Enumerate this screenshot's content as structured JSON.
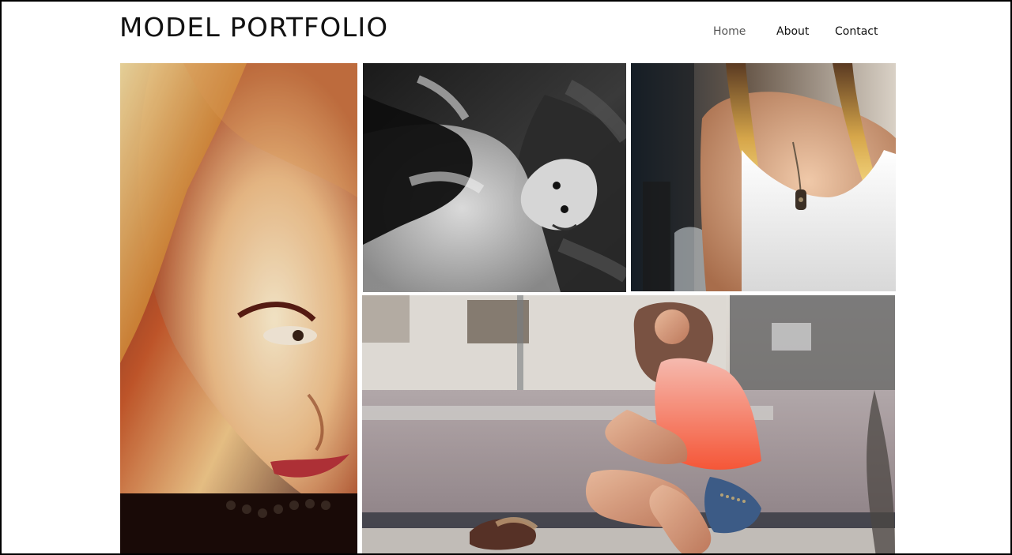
{
  "header": {
    "site_title": "MODEL PORTFOLIO"
  },
  "nav": {
    "items": [
      {
        "label": "Home"
      },
      {
        "label": "About"
      },
      {
        "label": "Contact"
      }
    ]
  },
  "gallery": {
    "items": [
      {
        "name": "closeup-portrait-photo"
      },
      {
        "name": "black-and-white-lying-photo"
      },
      {
        "name": "tank-top-photo"
      },
      {
        "name": "street-sitting-photo"
      }
    ]
  },
  "colors": {
    "border": "#000000",
    "title": "#111111",
    "nav_active": "#555555"
  }
}
